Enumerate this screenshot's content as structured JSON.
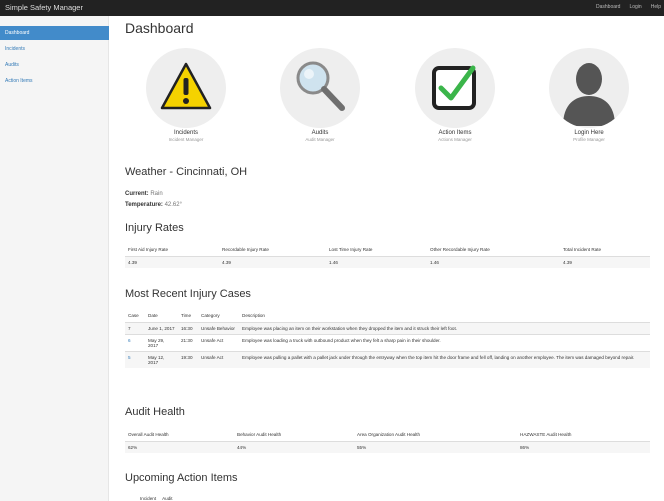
{
  "app": {
    "title": "Simple Safety Manager"
  },
  "nav": {
    "links": [
      "Dashboard",
      "Login",
      "Help"
    ]
  },
  "sidebar": {
    "items": [
      {
        "label": "Dashboard",
        "active": true
      },
      {
        "label": "Incidents",
        "active": false
      },
      {
        "label": "Audits",
        "active": false
      },
      {
        "label": "Action Items",
        "active": false
      }
    ]
  },
  "page": {
    "title": "Dashboard"
  },
  "tiles": [
    {
      "name": "Incidents",
      "sub": "Incident Manager",
      "icon": "warning-icon"
    },
    {
      "name": "Audits",
      "sub": "Audit Manager",
      "icon": "magnifier-icon"
    },
    {
      "name": "Action Items",
      "sub": "Actions Manager",
      "icon": "checkbox-icon"
    },
    {
      "name": "Login Here",
      "sub": "Profile Manager",
      "icon": "user-icon"
    }
  ],
  "weather": {
    "title": "Weather - Cincinnati, OH",
    "current_label": "Current:",
    "current_value": "Rain",
    "temp_label": "Temperature:",
    "temp_value": "42.62°"
  },
  "injury_rates": {
    "title": "Injury Rates",
    "headers": [
      "First Aid Injury Rate",
      "Recordable Injury Rate",
      "Lost Time Injury Rate",
      "Other Recordable Injury Rate",
      "Total Incident Rate"
    ],
    "values": [
      "4.39",
      "4.39",
      "1.46",
      "1.46",
      "4.39"
    ]
  },
  "recent_cases": {
    "title": "Most Recent Injury Cases",
    "headers": [
      "Case",
      "Date",
      "Time",
      "Category",
      "Description"
    ],
    "rows": [
      {
        "case": "7",
        "date": "June 1, 2017",
        "time": "16:30",
        "category": "Unsafe Behavior",
        "description": "Employee was placing an item on their workstation when they dropped the item and it struck their left foot."
      },
      {
        "case": "6",
        "date": "May 29, 2017",
        "time": "21:30",
        "category": "Unsafe Act",
        "description": "Employee was loading a truck with outbound product when they felt a sharp pain in their shoulder."
      },
      {
        "case": "5",
        "date": "May 12, 2017",
        "time": "19:30",
        "category": "Unsafe Act",
        "description": "Employee was pulling a pallet with a pallet jack under through the entryway when the top item hit the door frame and fell off, landing on another employee. The item was damaged beyond repair."
      }
    ]
  },
  "audit_health": {
    "title": "Audit Health",
    "headers": [
      "Overall Audit Health",
      "Behavior Audit Health",
      "Area Organization Audit Health",
      "HAZWASTE Audit Health"
    ],
    "values": [
      "62%",
      "44%",
      "55%",
      "86%"
    ]
  },
  "upcoming": {
    "title": "Upcoming Action Items",
    "headers": [
      "Incident",
      "Audit"
    ]
  },
  "colors": {
    "accent": "#428bca",
    "link": "#337ab7",
    "navbar": "#222222",
    "warning": "#f5d200",
    "check": "#3bb54a"
  }
}
